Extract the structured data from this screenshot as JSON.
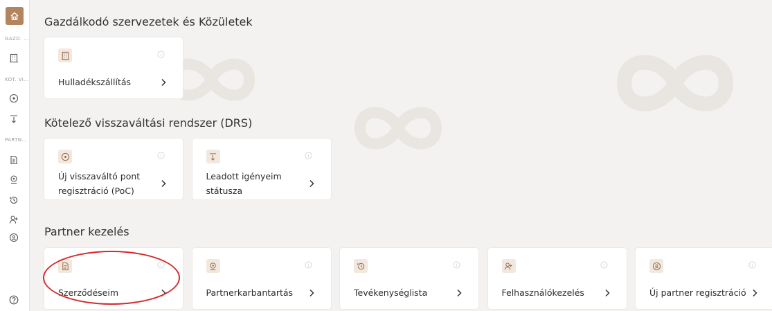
{
  "sidebar": {
    "home_icon": "home-icon",
    "groups": [
      {
        "label": "GAZD. ...",
        "icons": [
          "building-icon"
        ]
      },
      {
        "label": "KÖT. VI...",
        "icons": [
          "location-pin-icon",
          "download-icon"
        ]
      },
      {
        "label": "PARTN...",
        "icons": [
          "document-icon",
          "map-pin-icon",
          "history-icon",
          "add-user-icon",
          "pin-badge-icon"
        ]
      }
    ],
    "help_icon": "help-icon"
  },
  "sections": [
    {
      "title": "Gazdálkodó szervezetek és Közületek",
      "cards": [
        {
          "icon": "building-icon",
          "label_lines": [
            "Hulladékszállítás"
          ]
        }
      ]
    },
    {
      "title": "Kötelező visszaváltási rendszer (DRS)",
      "cards": [
        {
          "icon": "location-pin-icon",
          "label_lines": [
            "Új visszaváltó pont",
            "regisztráció (PoC)"
          ]
        },
        {
          "icon": "download-icon",
          "label_lines": [
            "Leadott igényeim",
            "státusza"
          ]
        }
      ]
    },
    {
      "title": "Partner kezelés",
      "cards": [
        {
          "icon": "document-icon",
          "label_lines": [
            "Szerződéseim"
          ]
        },
        {
          "icon": "map-pin-icon",
          "label_lines": [
            "Partnerkarbantartás"
          ]
        },
        {
          "icon": "history-icon",
          "label_lines": [
            "Tevékenységlista"
          ]
        },
        {
          "icon": "add-user-icon",
          "label_lines": [
            "Felhasználókezelés"
          ]
        },
        {
          "icon": "pin-badge-icon",
          "label_lines": [
            "Új partner regisztráció"
          ]
        }
      ]
    }
  ],
  "colors": {
    "accent": "#b3855f",
    "icon_bg": "#f1e8df",
    "highlight_ring": "#d42a2a"
  }
}
